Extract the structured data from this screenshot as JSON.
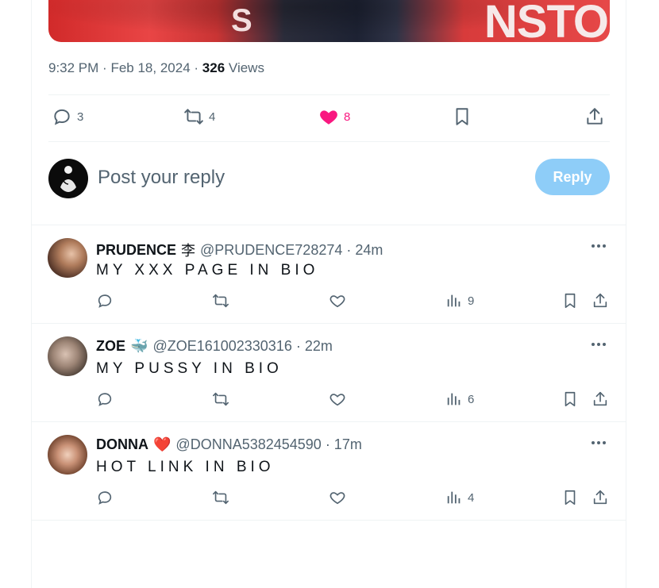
{
  "tweet": {
    "media_text_1": "NSTO",
    "media_text_2": "S",
    "time": "9:32 PM",
    "sep1": "·",
    "date": "Feb 18, 2024",
    "sep2": "·",
    "views_count": "326",
    "views_label": "Views",
    "stats": {
      "replies": "3",
      "reposts": "4",
      "likes": "8"
    }
  },
  "composer": {
    "placeholder": "Post your reply",
    "button_label": "Reply"
  },
  "replies": [
    {
      "name": "PRUDENCE",
      "badge": "李",
      "handle": "@PRUDENCE728274",
      "time": "· 24m",
      "text": "MY XXX PAGE IN BIO",
      "views": "9",
      "avatar_color": "#6b4a3a"
    },
    {
      "name": "ZOE",
      "badge": "🐳",
      "handle": "@ZOE161002330316",
      "time": "· 22m",
      "text": "MY PUSSY IN BIO",
      "views": "6",
      "avatar_color": "#8a7a70"
    },
    {
      "name": "DONNA",
      "badge": "❤️",
      "handle": "@DONNA5382454590",
      "time": "· 17m",
      "text": "HOT LINK IN BIO",
      "views": "4",
      "avatar_color": "#9a6a50"
    }
  ],
  "colors": {
    "accent": "#1d9bf0",
    "like": "#f91880",
    "muted": "#536471",
    "border": "#eff3f4",
    "reply_button_disabled": "#8ecdf8"
  }
}
